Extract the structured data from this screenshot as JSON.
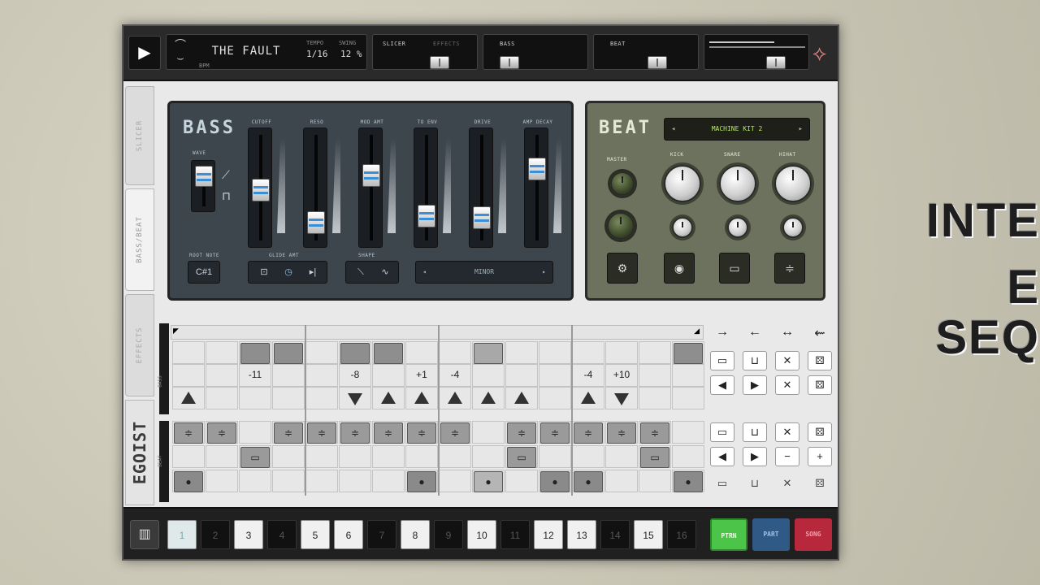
{
  "topbar": {
    "song_name": "THE FAULT",
    "tempo_label": "TEMPO",
    "tempo_value": "1/16",
    "swing_label": "SWING",
    "swing_value": "12 %",
    "bpm_label": "BPM",
    "slicer_label": "SLICER",
    "effects_label": "EFFECTS",
    "bass_label": "BASS",
    "beat_label": "BEAT"
  },
  "sidetabs": [
    "SLICER",
    "BASS/BEAT",
    "EFFECTS"
  ],
  "brand": "EGOIST",
  "bass": {
    "title": "BASS",
    "wave_label": "WAVE",
    "fader_labels": [
      "CUTOFF",
      "RESO",
      "MOD AMT",
      "TO ENV",
      "DRIVE",
      "AMP DECAY"
    ],
    "root_label": "ROOT NOTE",
    "root_value": "C#1",
    "glide_label": "GLIDE AMT",
    "shape_label": "SHAPE",
    "scale_value": "MINOR",
    "prev_arrow": "◂",
    "next_arrow": "▸"
  },
  "beat": {
    "title": "BEAT",
    "kit": "MACHINE KIT 2",
    "knob_labels": [
      "MASTER",
      "KICK",
      "SNARE",
      "HIHAT"
    ]
  },
  "sequencer": {
    "note_offsets": [
      "-11",
      "-8",
      "+1",
      "-4",
      "-4",
      "+10"
    ],
    "bass_track_label": "BASS",
    "beat_track_label": "BEAT"
  },
  "steps": [
    "1",
    "2",
    "3",
    "4",
    "5",
    "6",
    "7",
    "8",
    "9",
    "10",
    "11",
    "12",
    "13",
    "14",
    "15",
    "16"
  ],
  "modes": {
    "pattern": "PTRN",
    "part": "PART",
    "song": "SONG"
  },
  "overlay": {
    "line1": "INTE",
    "line2": "E",
    "line3": "SEQ"
  }
}
